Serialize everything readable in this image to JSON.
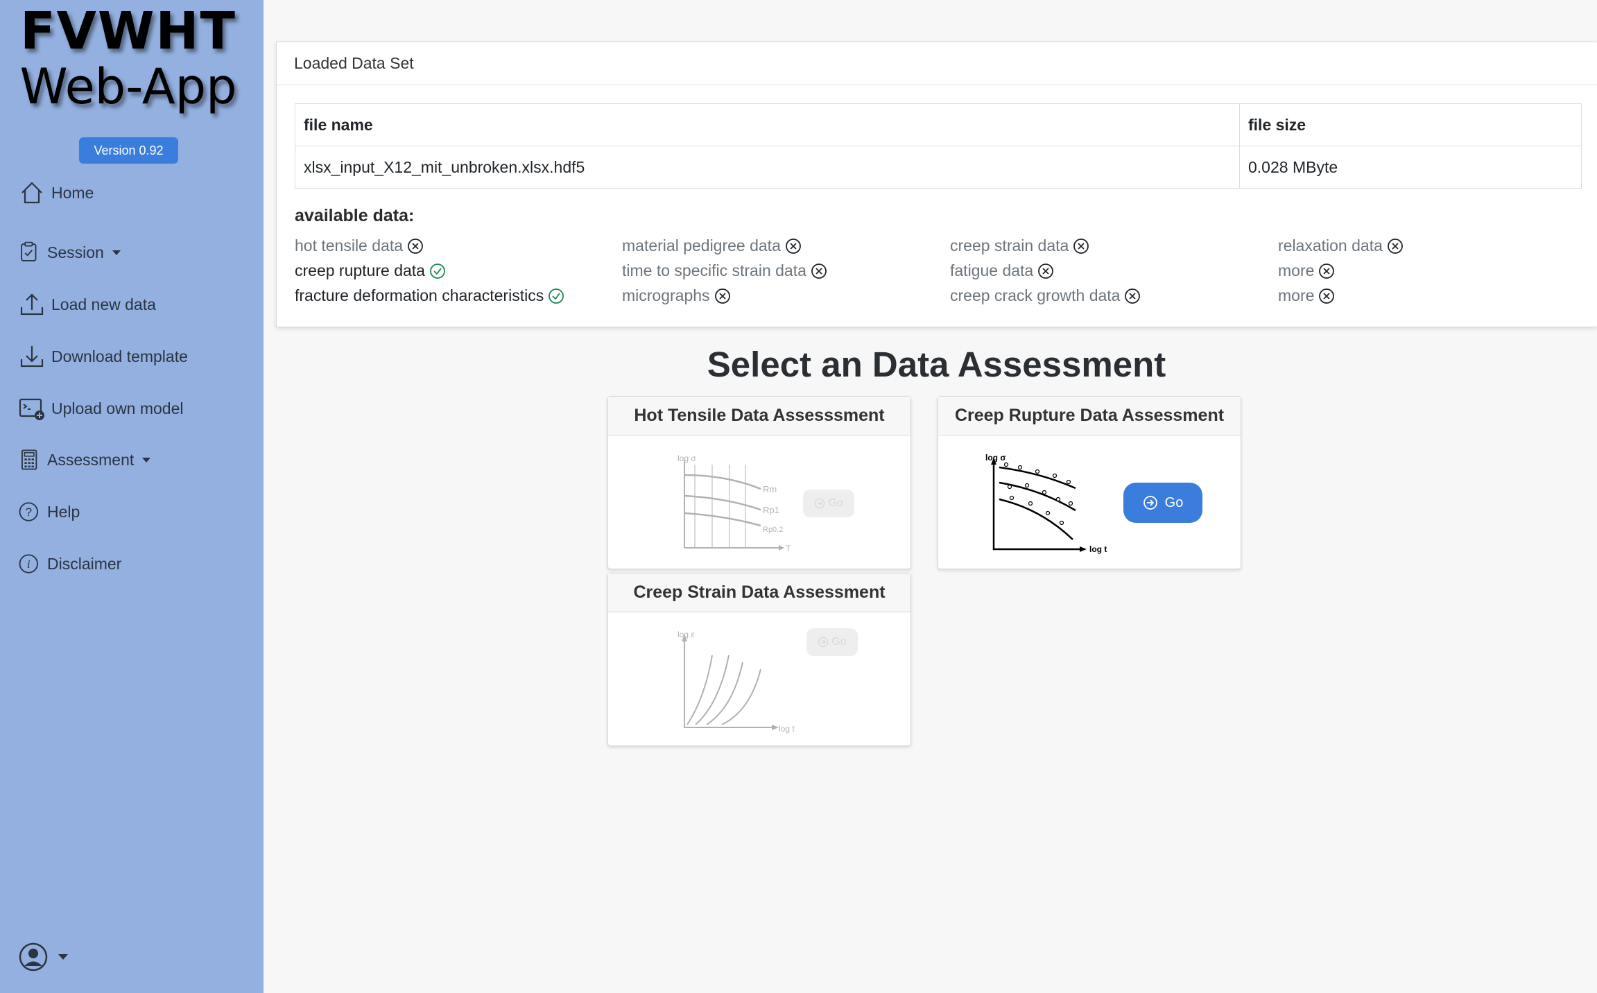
{
  "app": {
    "logo_line1": "FVWHT",
    "logo_line2": "Web-App",
    "version": "Version 0.92",
    "brand_color": "#3b7ddd",
    "sidebar_color": "#93b0e0"
  },
  "nav": {
    "home": "Home",
    "session": "Session",
    "load_new_data": "Load new data",
    "download_template": "Download template",
    "upload_own_model": "Upload own model",
    "assessment": "Assessment",
    "help": "Help",
    "disclaimer": "Disclaimer"
  },
  "loaded": {
    "header": "Loaded Data Set",
    "columns": [
      "file name",
      "file size"
    ],
    "file_name": "xlsx_input_X12_mit_unbroken.xlsx.hdf5",
    "file_size": "0.028 MByte",
    "available_title": "available data:",
    "available": [
      {
        "label": "hot tensile data",
        "status": "unavailable"
      },
      {
        "label": "material pedigree data",
        "status": "unavailable"
      },
      {
        "label": "creep strain data",
        "status": "unavailable"
      },
      {
        "label": "relaxation data",
        "status": "unavailable"
      },
      {
        "label": "creep rupture data",
        "status": "available"
      },
      {
        "label": "time to specific strain data",
        "status": "unavailable"
      },
      {
        "label": "fatigue data",
        "status": "unavailable"
      },
      {
        "label": "more",
        "status": "unavailable"
      },
      {
        "label": "fracture deformation characteristics",
        "status": "available"
      },
      {
        "label": "micrographs",
        "status": "unavailable"
      },
      {
        "label": "creep crack growth data",
        "status": "unavailable"
      },
      {
        "label": "more",
        "status": "unavailable"
      }
    ]
  },
  "assess": {
    "title": "Select an Data Assessment",
    "go": "Go",
    "cards": [
      {
        "title": "Hot Tensile Data Assesssment",
        "enabled": false,
        "y_label": "log σ",
        "x_label": "T",
        "curve_labels": [
          "Rm",
          "Rp1",
          "Rp0.2"
        ]
      },
      {
        "title": "Creep Rupture Data Assessment",
        "enabled": true,
        "y_label": "log σ",
        "x_label": "log t"
      },
      {
        "title": "Creep Strain Data Assessment",
        "enabled": false,
        "y_label": "log ε",
        "x_label": "log t"
      }
    ]
  }
}
